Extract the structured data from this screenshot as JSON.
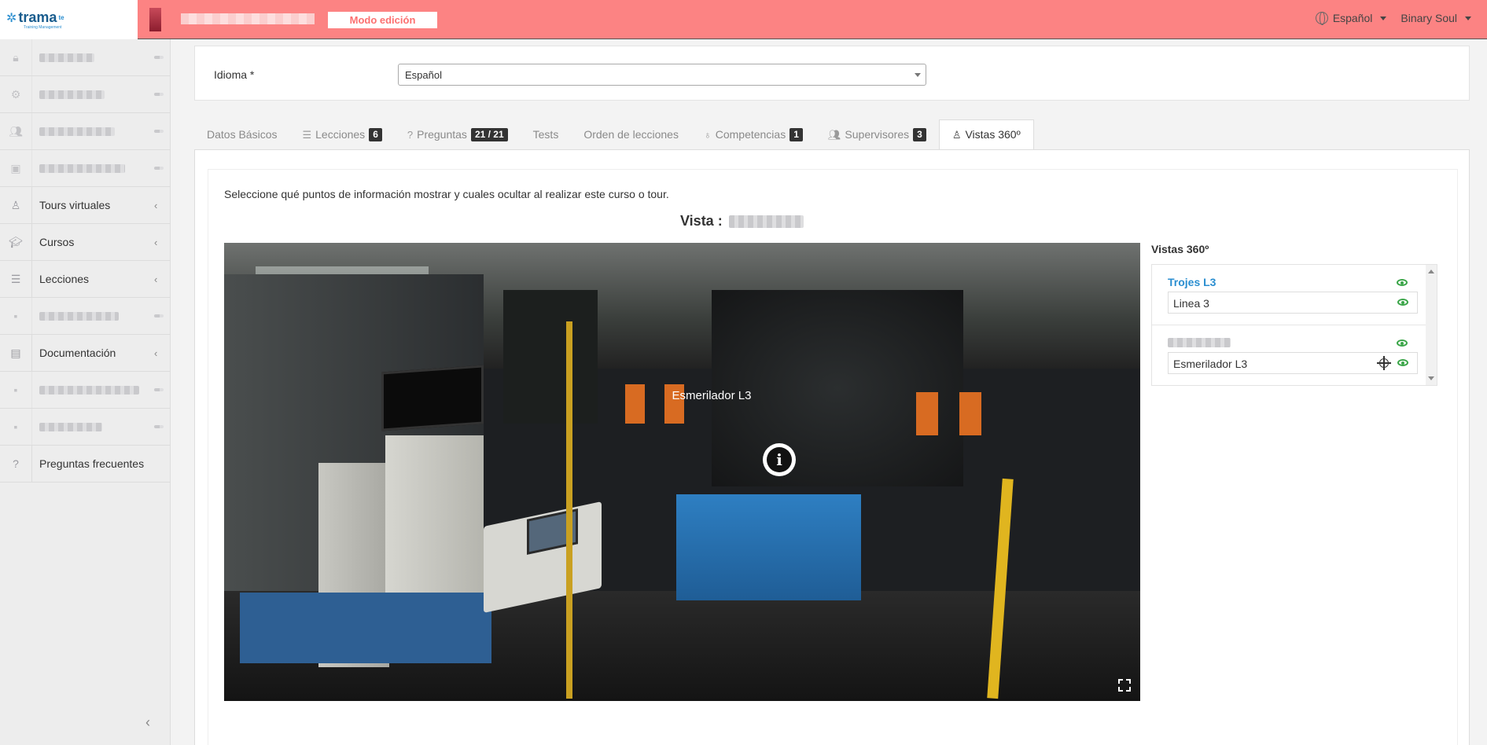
{
  "app": {
    "logo_text": "trama",
    "logo_sup": "te",
    "logo_sub": "Training Management",
    "mode_badge": "Modo edición",
    "language": "Español",
    "user": "Binary Soul"
  },
  "sidebar": {
    "items": [
      {
        "icon": "lock-icon",
        "label": "",
        "blurred": true,
        "has_chevron": false
      },
      {
        "icon": "cogs-icon",
        "label": "",
        "blurred": true,
        "has_chevron": false
      },
      {
        "icon": "users-icon",
        "label": "",
        "blurred": true,
        "has_chevron": false
      },
      {
        "icon": "teacher-icon",
        "label": "",
        "blurred": true,
        "has_chevron": false
      },
      {
        "icon": "street-view-icon",
        "label": "Tours virtuales",
        "blurred": false,
        "has_chevron": true
      },
      {
        "icon": "graduation-cap-icon",
        "label": "Cursos",
        "blurred": false,
        "has_chevron": true
      },
      {
        "icon": "list-icon",
        "label": "Lecciones",
        "blurred": false,
        "has_chevron": true
      },
      {
        "icon": "blurred-icon",
        "label": "",
        "blurred": true,
        "has_chevron": false
      },
      {
        "icon": "file-icon",
        "label": "Documentación",
        "blurred": false,
        "has_chevron": true
      },
      {
        "icon": "blurred-icon",
        "label": "",
        "blurred": true,
        "has_chevron": false
      },
      {
        "icon": "blurred-icon",
        "label": "",
        "blurred": true,
        "has_chevron": false
      },
      {
        "icon": "question-icon",
        "label": "Preguntas frecuentes",
        "blurred": false,
        "has_chevron": false
      }
    ]
  },
  "form": {
    "language_label": "Idioma *",
    "language_value": "Español"
  },
  "tabs": [
    {
      "label": "Datos Básicos",
      "badge": "",
      "icon": ""
    },
    {
      "label": "Lecciones",
      "badge": "6",
      "icon": "list-icon"
    },
    {
      "label": "Preguntas",
      "badge": "21 / 21",
      "icon": "question-icon"
    },
    {
      "label": "Tests",
      "badge": "",
      "icon": ""
    },
    {
      "label": "Orden de lecciones",
      "badge": "",
      "icon": ""
    },
    {
      "label": "Competencias",
      "badge": "1",
      "icon": "award-icon"
    },
    {
      "label": "Supervisores",
      "badge": "3",
      "icon": "users-icon"
    },
    {
      "label": "Vistas 360º",
      "badge": "",
      "icon": "street-view-icon",
      "active": true
    }
  ],
  "content": {
    "instruction": "Seleccione qué puntos de información mostrar y cuales ocultar al realizar este curso o tour.",
    "vista_label": "Vista :",
    "hotspot_label": "Esmerilador L3"
  },
  "vistas_panel": {
    "title": "Vistas 360º",
    "groups": [
      {
        "name": "Trojes L3",
        "items": [
          "Linea 3"
        ]
      },
      {
        "name": "",
        "items": [
          "Esmerilador L3"
        ]
      }
    ]
  },
  "colors": {
    "topbar": "#fc8383",
    "accent_blue": "#2a8ed0",
    "eye_green": "#3aa548"
  }
}
